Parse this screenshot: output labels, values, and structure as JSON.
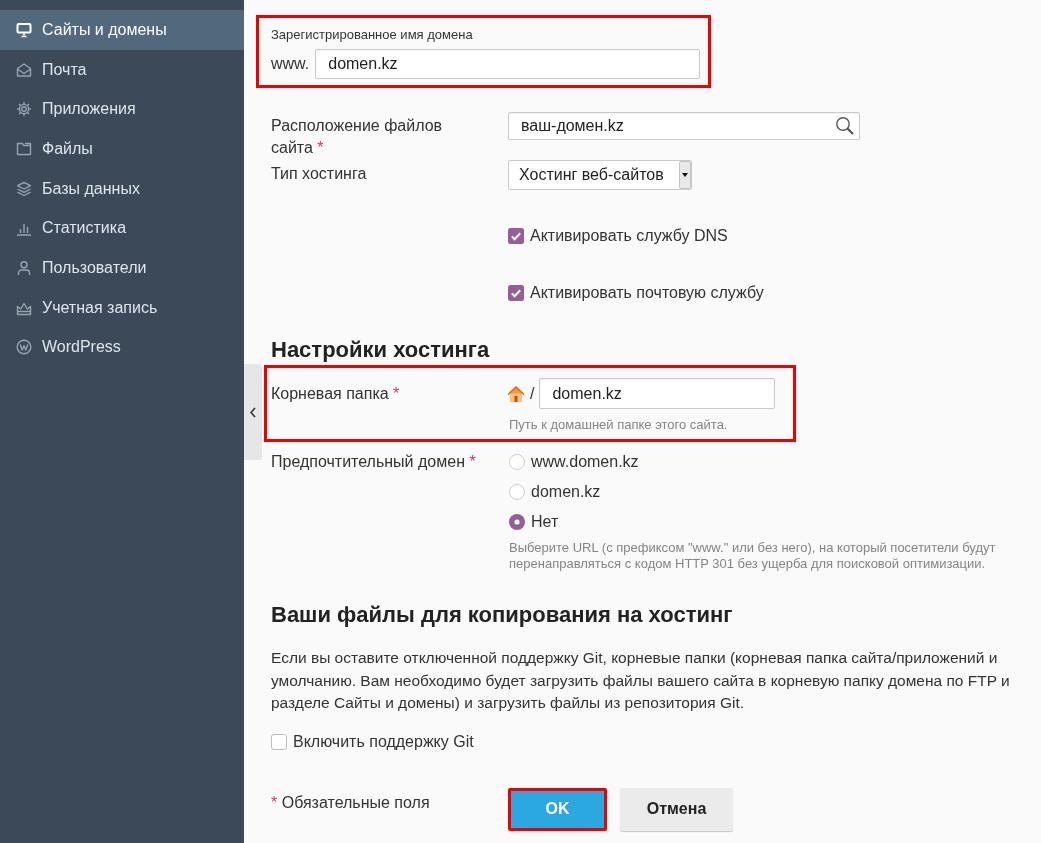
{
  "sidebar": {
    "collapsible": true,
    "items": [
      {
        "label": "Сайты и домены",
        "kind": "monitor",
        "selected": true
      },
      {
        "label": "Почта",
        "kind": "envelope",
        "selected": false
      },
      {
        "label": "Приложения",
        "kind": "gear",
        "selected": false
      },
      {
        "label": "Файлы",
        "kind": "folder",
        "selected": false
      },
      {
        "label": "Базы данных",
        "kind": "layers",
        "selected": false
      },
      {
        "label": "Статистика",
        "kind": "bars",
        "selected": false
      },
      {
        "label": "Пользователи",
        "kind": "person",
        "selected": false
      },
      {
        "label": "Учетная запись",
        "kind": "crown",
        "selected": false
      },
      {
        "label": "WordPress",
        "kind": "wlogo",
        "selected": false
      }
    ]
  },
  "domain": {
    "label": "Зарегистрированное имя домена",
    "prefix": "www.",
    "value": "domen.kz",
    "highlighted": true
  },
  "fields": [
    {
      "kind": "search",
      "label": "Расположение файлов сайта",
      "required_mark": "*",
      "value": "ваш-домен.kz"
    },
    {
      "kind": "select",
      "label": "Тип хостинга",
      "value": "Хостинг веб-сайтов"
    },
    {
      "kind": "checkbox",
      "label": "Активировать службу DNS",
      "checked": true
    },
    {
      "kind": "checkbox",
      "label": "Активировать почтовую службу",
      "checked": true
    }
  ],
  "hosting_settings": {
    "title": "Настройки хостинга",
    "document_root": {
      "label": "Корневая папка",
      "required_mark": "*",
      "separator": "/",
      "value": "domen.kz",
      "hint": "Путь к домашней папке этого сайта.",
      "highlighted": true
    },
    "preferred_domain": {
      "label": "Предпочтительный домен",
      "required_mark": "*",
      "options": [
        {
          "label": "www.domen.kz",
          "selected": false
        },
        {
          "label": "domen.kz",
          "selected": false
        },
        {
          "label": "Нет",
          "selected": true
        }
      ],
      "hint": "Выберите URL (с префиксом \"www.\" или без него), на который посетители будут перенаправляться с кодом HTTP 301 без ущерба для поисковой оптимизации."
    }
  },
  "files_section": {
    "title": "Ваши файлы для копирования на хостинг",
    "description_lines": [
      "Если вы оставите отключенной поддержку Git, корневые папки (корневая папка сайта/приложений и",
      "умолчанию. Вам необходимо будет загрузить файлы вашего сайта в корневую папку домена по FTP и",
      "разделе Сайты и домены) и загрузить файлы из репозитория Git."
    ],
    "git_checkbox": {
      "label": "Включить поддержку Git",
      "checked": false
    }
  },
  "footer": {
    "required_mark": "*",
    "required_note": "Обязательные поля",
    "buttons": [
      {
        "label": "OK",
        "kind": "primary",
        "highlighted": true
      },
      {
        "label": "Отмена",
        "kind": "secondary",
        "highlighted": false
      }
    ]
  }
}
